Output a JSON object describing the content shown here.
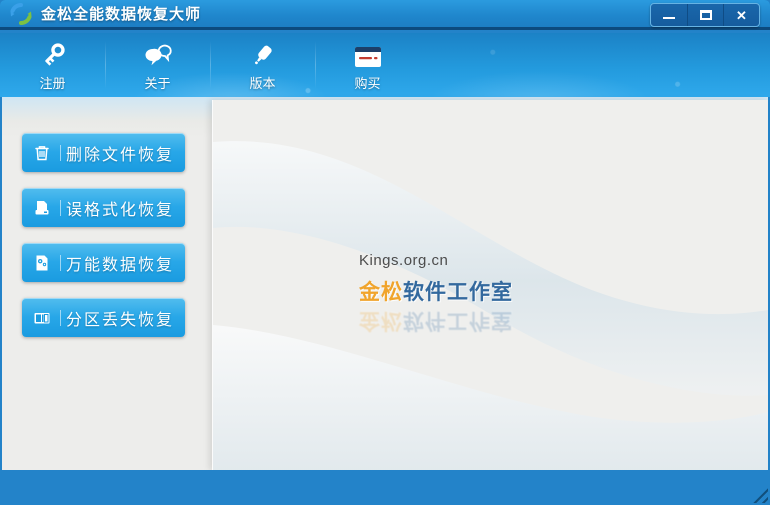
{
  "window": {
    "title": "金松全能数据恢复大师",
    "controls": {
      "minimize_icon": "minimize-icon",
      "maximize_icon": "maximize-icon",
      "close_icon": "close-icon",
      "close_glyph": "✕"
    }
  },
  "toolbar": {
    "items": [
      {
        "label": "注册",
        "icon": "key-icon"
      },
      {
        "label": "关于",
        "icon": "chat-bubbles-icon"
      },
      {
        "label": "版本",
        "icon": "glue-pen-icon"
      },
      {
        "label": "购买",
        "icon": "banknote-icon"
      }
    ]
  },
  "sidebar": {
    "buttons": [
      {
        "label": "删除文件恢复",
        "icon": "trash-icon"
      },
      {
        "label": "误格式化恢复",
        "icon": "format-disk-icon"
      },
      {
        "label": "万能数据恢复",
        "icon": "document-gear-icon"
      },
      {
        "label": "分区丢失恢复",
        "icon": "partition-icon"
      }
    ]
  },
  "main": {
    "watermark_url": "Kings.org.cn",
    "brand_first": "金松",
    "brand_rest": "软件工作室"
  },
  "colors": {
    "titlebar_blue": "#1f86cc",
    "titlebar_dark_edge": "#0c4a7e",
    "toolbar_top": "#1b82c6",
    "toolbar_bottom": "#2fa9ec",
    "frame_blue": "#2383c9",
    "content_bg": "#ededeb",
    "button_top": "#52bdee",
    "button_bottom": "#1a9be0",
    "brand_orange": "#f0a42c",
    "brand_blue": "#33699e",
    "watermark_gray": "#4c4c4c"
  }
}
